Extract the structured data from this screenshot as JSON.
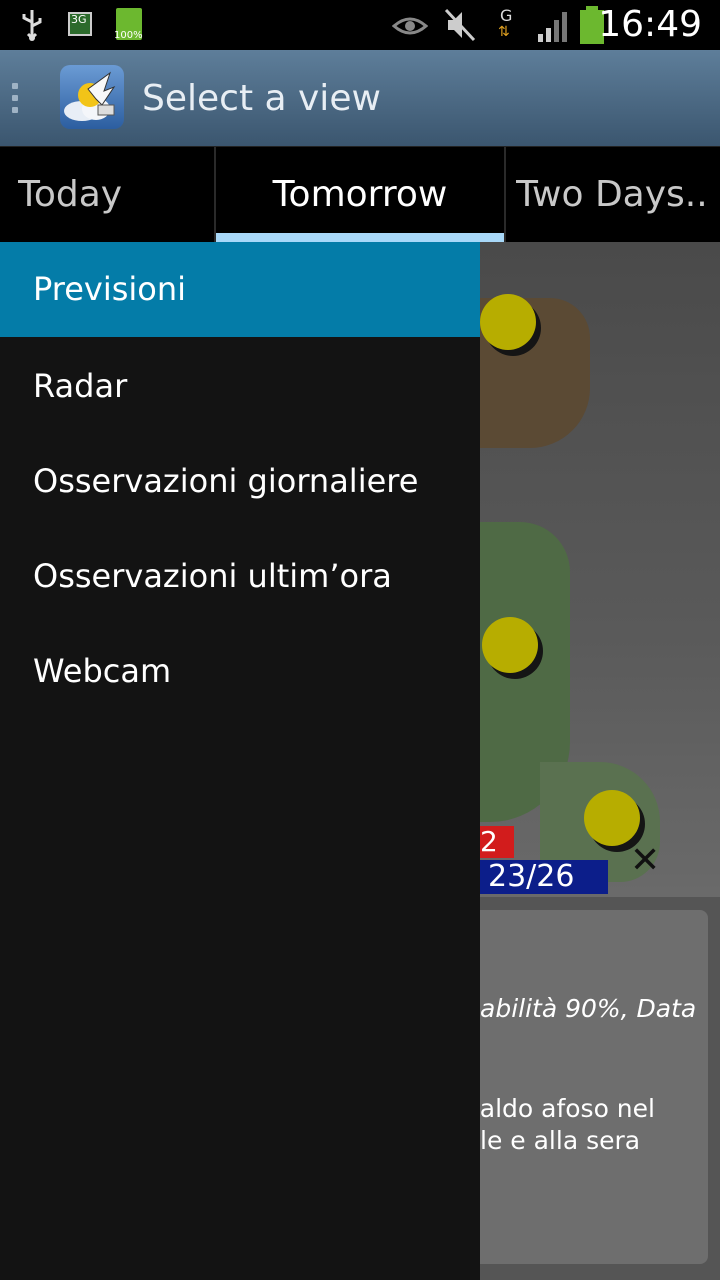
{
  "status_bar": {
    "time": "16:49",
    "battery_percent_label": "100%",
    "network_label": "3G",
    "data_label": "G",
    "icons": [
      "usb-icon",
      "sim-icon",
      "battery-small-icon",
      "eye-icon",
      "mute-icon",
      "data-arrows-icon",
      "signal-icon",
      "battery-icon"
    ]
  },
  "action_bar": {
    "title": "Select a view",
    "icon": "app-logo-icon"
  },
  "tabs": [
    {
      "label": "Today",
      "selected": false
    },
    {
      "label": "Tomorrow",
      "selected": true
    },
    {
      "label": "Two Days.."
    }
  ],
  "drawer": {
    "items": [
      {
        "label": "Previsioni",
        "active": true
      },
      {
        "label": "Radar"
      },
      {
        "label": "Osservazioni giornaliere"
      },
      {
        "label": "Osservazioni ultim’ora"
      },
      {
        "label": "Webcam"
      }
    ]
  },
  "background": {
    "map_label_red": "2",
    "map_label_blue": "23/26",
    "card_line1": "abilità 90%, Data",
    "card_line2": "caldo afoso nel",
    "card_line3": "le e alla sera"
  },
  "colors": {
    "accent": "#047ca8",
    "tab_indicator": "#a8d8f8",
    "drawer_bg": "#131313",
    "actionbar_top": "#5e7e9a"
  }
}
